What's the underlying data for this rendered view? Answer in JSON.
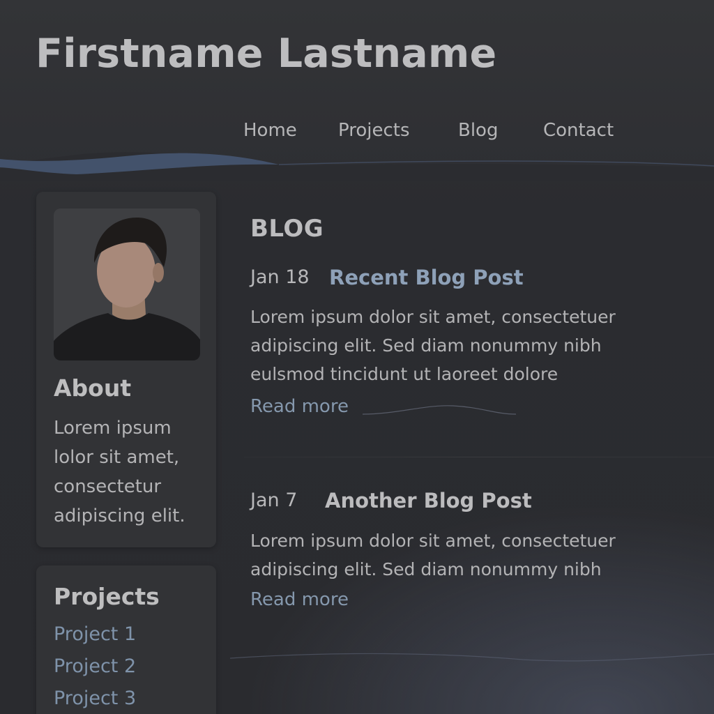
{
  "header": {
    "title": "Firstname Lastname",
    "nav": [
      "Home",
      "Projects",
      "Blog",
      "Contact"
    ]
  },
  "sidebar": {
    "about": {
      "heading": "About",
      "text": "Lorem ipsum lolor sit amet, consectetur adipiscing elit.",
      "avatar": "profile-photo"
    },
    "projects": {
      "heading": "Projects",
      "items": [
        "Project 1",
        "Project 2",
        "Project 3"
      ]
    }
  },
  "blog": {
    "heading": "BLOG",
    "posts": [
      {
        "date": "Jan 18",
        "title": "Recent Blog Post",
        "excerpt": "Lorem ipsum dolor sit amet, consectetuer adipiscing elit. Sed diam nonummy nibh eulsmod tincidunt ut laoreet dolore",
        "read_more": "Read more"
      },
      {
        "date": "Jan 7",
        "title": "Another Blog Post",
        "excerpt": "Lorem ipsum dolor sit amet, consectetuer adipiscing elit. Sed diam nonummy nibh",
        "read_more": "Read more"
      }
    ]
  },
  "colors": {
    "background": "#2b2c30",
    "card": "#323336",
    "link": "#8598ad",
    "accent_wave": "#4a5a78",
    "recent_post_title": "#8ea1b8",
    "text": "#b8b8ba"
  }
}
